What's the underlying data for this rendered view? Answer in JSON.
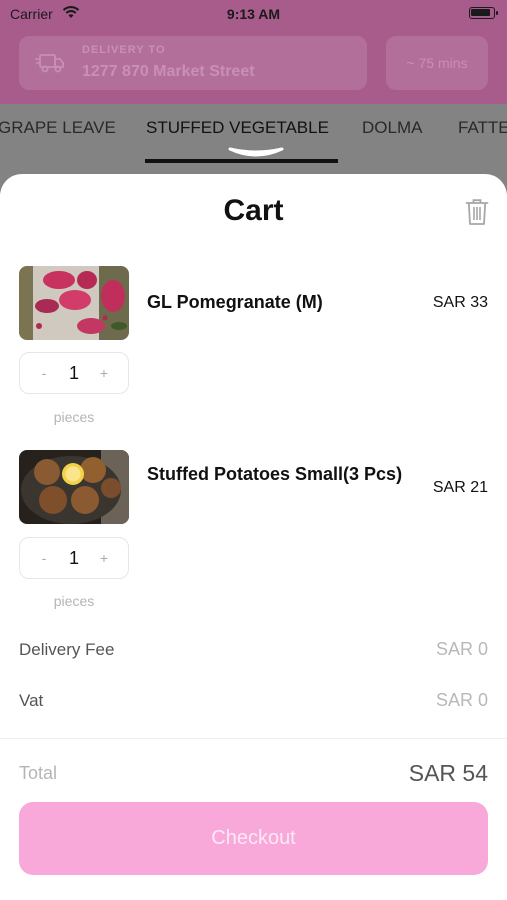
{
  "status_bar": {
    "carrier": "Carrier",
    "time": "9:13 AM"
  },
  "header": {
    "delivery_label": "DELIVERY TO",
    "delivery_address": "1277 870 Market Street",
    "eta": "~ 75 mins"
  },
  "tabs": [
    {
      "label": "GRAPE LEAVE"
    },
    {
      "label": "STUFFED VEGETABLE"
    },
    {
      "label": "DOLMA"
    },
    {
      "label": "FATTE"
    }
  ],
  "cart": {
    "title": "Cart",
    "items": [
      {
        "name": "GL Pomegranate (M)",
        "price": "SAR 33",
        "quantity": "1",
        "minus": "-",
        "plus": "+",
        "unit": "pieces"
      },
      {
        "name": "Stuffed Potatoes Small(3 Pcs)",
        "price": "SAR 21",
        "quantity": "1",
        "minus": "-",
        "plus": "+",
        "unit": "pieces"
      }
    ],
    "delivery_fee": {
      "label": "Delivery Fee",
      "value": "SAR 0"
    },
    "vat": {
      "label": "Vat",
      "value": "SAR 0"
    },
    "total": {
      "label": "Total",
      "value": "SAR 54"
    },
    "checkout_label": "Checkout"
  },
  "colors": {
    "accent": "#f9a8da",
    "overlay_header": "#a85c8c"
  },
  "icons": [
    "wifi-icon",
    "battery-icon",
    "truck-icon",
    "chevron-down-icon",
    "trash-icon"
  ]
}
